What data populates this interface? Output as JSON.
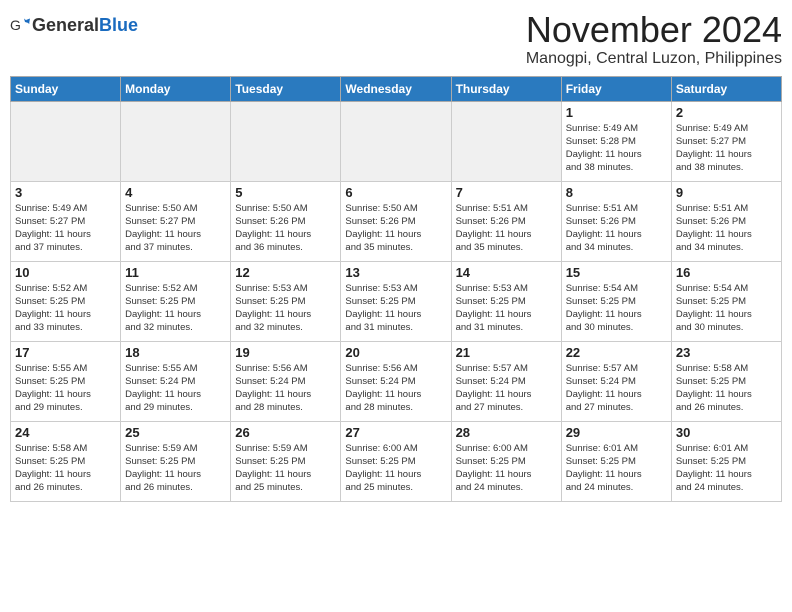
{
  "header": {
    "logo_general": "General",
    "logo_blue": "Blue",
    "month_title": "November 2024",
    "location": "Manogpi, Central Luzon, Philippines"
  },
  "weekdays": [
    "Sunday",
    "Monday",
    "Tuesday",
    "Wednesday",
    "Thursday",
    "Friday",
    "Saturday"
  ],
  "weeks": [
    [
      {
        "day": "",
        "info": ""
      },
      {
        "day": "",
        "info": ""
      },
      {
        "day": "",
        "info": ""
      },
      {
        "day": "",
        "info": ""
      },
      {
        "day": "",
        "info": ""
      },
      {
        "day": "1",
        "info": "Sunrise: 5:49 AM\nSunset: 5:28 PM\nDaylight: 11 hours\nand 38 minutes."
      },
      {
        "day": "2",
        "info": "Sunrise: 5:49 AM\nSunset: 5:27 PM\nDaylight: 11 hours\nand 38 minutes."
      }
    ],
    [
      {
        "day": "3",
        "info": "Sunrise: 5:49 AM\nSunset: 5:27 PM\nDaylight: 11 hours\nand 37 minutes."
      },
      {
        "day": "4",
        "info": "Sunrise: 5:50 AM\nSunset: 5:27 PM\nDaylight: 11 hours\nand 37 minutes."
      },
      {
        "day": "5",
        "info": "Sunrise: 5:50 AM\nSunset: 5:26 PM\nDaylight: 11 hours\nand 36 minutes."
      },
      {
        "day": "6",
        "info": "Sunrise: 5:50 AM\nSunset: 5:26 PM\nDaylight: 11 hours\nand 35 minutes."
      },
      {
        "day": "7",
        "info": "Sunrise: 5:51 AM\nSunset: 5:26 PM\nDaylight: 11 hours\nand 35 minutes."
      },
      {
        "day": "8",
        "info": "Sunrise: 5:51 AM\nSunset: 5:26 PM\nDaylight: 11 hours\nand 34 minutes."
      },
      {
        "day": "9",
        "info": "Sunrise: 5:51 AM\nSunset: 5:26 PM\nDaylight: 11 hours\nand 34 minutes."
      }
    ],
    [
      {
        "day": "10",
        "info": "Sunrise: 5:52 AM\nSunset: 5:25 PM\nDaylight: 11 hours\nand 33 minutes."
      },
      {
        "day": "11",
        "info": "Sunrise: 5:52 AM\nSunset: 5:25 PM\nDaylight: 11 hours\nand 32 minutes."
      },
      {
        "day": "12",
        "info": "Sunrise: 5:53 AM\nSunset: 5:25 PM\nDaylight: 11 hours\nand 32 minutes."
      },
      {
        "day": "13",
        "info": "Sunrise: 5:53 AM\nSunset: 5:25 PM\nDaylight: 11 hours\nand 31 minutes."
      },
      {
        "day": "14",
        "info": "Sunrise: 5:53 AM\nSunset: 5:25 PM\nDaylight: 11 hours\nand 31 minutes."
      },
      {
        "day": "15",
        "info": "Sunrise: 5:54 AM\nSunset: 5:25 PM\nDaylight: 11 hours\nand 30 minutes."
      },
      {
        "day": "16",
        "info": "Sunrise: 5:54 AM\nSunset: 5:25 PM\nDaylight: 11 hours\nand 30 minutes."
      }
    ],
    [
      {
        "day": "17",
        "info": "Sunrise: 5:55 AM\nSunset: 5:25 PM\nDaylight: 11 hours\nand 29 minutes."
      },
      {
        "day": "18",
        "info": "Sunrise: 5:55 AM\nSunset: 5:24 PM\nDaylight: 11 hours\nand 29 minutes."
      },
      {
        "day": "19",
        "info": "Sunrise: 5:56 AM\nSunset: 5:24 PM\nDaylight: 11 hours\nand 28 minutes."
      },
      {
        "day": "20",
        "info": "Sunrise: 5:56 AM\nSunset: 5:24 PM\nDaylight: 11 hours\nand 28 minutes."
      },
      {
        "day": "21",
        "info": "Sunrise: 5:57 AM\nSunset: 5:24 PM\nDaylight: 11 hours\nand 27 minutes."
      },
      {
        "day": "22",
        "info": "Sunrise: 5:57 AM\nSunset: 5:24 PM\nDaylight: 11 hours\nand 27 minutes."
      },
      {
        "day": "23",
        "info": "Sunrise: 5:58 AM\nSunset: 5:25 PM\nDaylight: 11 hours\nand 26 minutes."
      }
    ],
    [
      {
        "day": "24",
        "info": "Sunrise: 5:58 AM\nSunset: 5:25 PM\nDaylight: 11 hours\nand 26 minutes."
      },
      {
        "day": "25",
        "info": "Sunrise: 5:59 AM\nSunset: 5:25 PM\nDaylight: 11 hours\nand 26 minutes."
      },
      {
        "day": "26",
        "info": "Sunrise: 5:59 AM\nSunset: 5:25 PM\nDaylight: 11 hours\nand 25 minutes."
      },
      {
        "day": "27",
        "info": "Sunrise: 6:00 AM\nSunset: 5:25 PM\nDaylight: 11 hours\nand 25 minutes."
      },
      {
        "day": "28",
        "info": "Sunrise: 6:00 AM\nSunset: 5:25 PM\nDaylight: 11 hours\nand 24 minutes."
      },
      {
        "day": "29",
        "info": "Sunrise: 6:01 AM\nSunset: 5:25 PM\nDaylight: 11 hours\nand 24 minutes."
      },
      {
        "day": "30",
        "info": "Sunrise: 6:01 AM\nSunset: 5:25 PM\nDaylight: 11 hours\nand 24 minutes."
      }
    ]
  ]
}
